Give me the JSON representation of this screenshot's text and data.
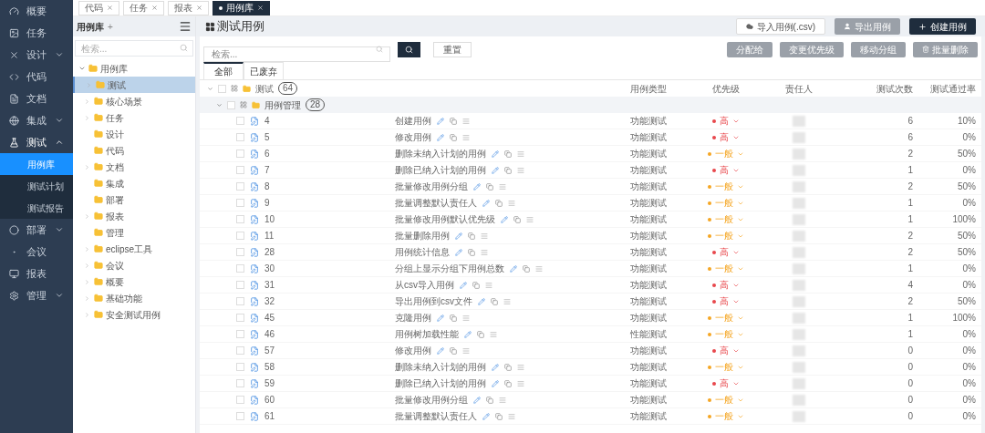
{
  "sidebar": {
    "items": [
      {
        "label": "概要",
        "expandable": false
      },
      {
        "label": "任务",
        "expandable": false
      },
      {
        "label": "设计",
        "expandable": true,
        "expanded": false
      },
      {
        "label": "代码",
        "expandable": false
      },
      {
        "label": "文档",
        "expandable": false
      },
      {
        "label": "集成",
        "expandable": true,
        "expanded": false
      },
      {
        "label": "测试",
        "expandable": true,
        "expanded": true,
        "children": [
          {
            "label": "用例库",
            "selected": true
          },
          {
            "label": "测试计划",
            "selected": false
          },
          {
            "label": "测试报告",
            "selected": false
          }
        ]
      },
      {
        "label": "部署",
        "expandable": true,
        "expanded": false
      },
      {
        "label": "会议",
        "expandable": false
      },
      {
        "label": "报表",
        "expandable": false
      },
      {
        "label": "管理",
        "expandable": true,
        "expanded": false
      }
    ]
  },
  "open_tabs": [
    {
      "label": "代码",
      "selected": false
    },
    {
      "label": "任务",
      "selected": false
    },
    {
      "label": "报表",
      "selected": false
    },
    {
      "label": "用例库",
      "selected": true
    }
  ],
  "tree_panel": {
    "title": "用例库",
    "add": "+",
    "search": {
      "placeholder": "检索..."
    },
    "root": {
      "label": "用例库",
      "expanded": true,
      "children": [
        {
          "label": "测试",
          "has_children": true,
          "selected": true
        },
        {
          "label": "核心场景",
          "has_children": true,
          "selected": false
        },
        {
          "label": "任务",
          "has_children": true,
          "selected": false
        },
        {
          "label": "设计",
          "has_children": false,
          "selected": false
        },
        {
          "label": "代码",
          "has_children": false,
          "selected": false
        },
        {
          "label": "文档",
          "has_children": true,
          "selected": false
        },
        {
          "label": "集成",
          "has_children": false,
          "selected": false
        },
        {
          "label": "部署",
          "has_children": false,
          "selected": false
        },
        {
          "label": "报表",
          "has_children": true,
          "selected": false
        },
        {
          "label": "管理",
          "has_children": false,
          "selected": false
        },
        {
          "label": "eclipse工具",
          "has_children": true,
          "selected": false
        },
        {
          "label": "会议",
          "has_children": true,
          "selected": false
        },
        {
          "label": "概要",
          "has_children": true,
          "selected": false
        },
        {
          "label": "基础功能",
          "has_children": true,
          "selected": false
        },
        {
          "label": "安全测试用例",
          "has_children": true,
          "selected": false
        }
      ]
    }
  },
  "page": {
    "title": "测试用例",
    "header_buttons": [
      {
        "label": "导入用例(.csv)",
        "kind": "outline"
      },
      {
        "label": "导出用例",
        "kind": "gray"
      },
      {
        "label": "创建用例",
        "kind": "dark"
      }
    ],
    "search": {
      "placeholder": "检索...",
      "reset": "重置"
    },
    "actions": [
      "分配给",
      "变更优先级",
      "移动分组",
      "批量删除"
    ],
    "tabs": [
      {
        "label": "全部",
        "selected": true
      },
      {
        "label": "已废弃",
        "selected": false
      }
    ]
  },
  "table": {
    "columns": [
      "用例类型",
      "优先级",
      "责任人",
      "测试次数",
      "测试通过率"
    ],
    "group": {
      "label": "测试",
      "count": "64",
      "expanded": true,
      "checked": false
    },
    "subgroup": {
      "label": "用例管理",
      "count": "28",
      "expanded": true,
      "checked": false
    },
    "rows": [
      {
        "id": "4",
        "title": "创建用例",
        "type": "功能测试",
        "priority": "高",
        "color": "#e8474c",
        "runs": "6",
        "pass_rate": "10%",
        "checked": false
      },
      {
        "id": "5",
        "title": "修改用例",
        "type": "功能测试",
        "priority": "高",
        "color": "#e8474c",
        "runs": "6",
        "pass_rate": "0%",
        "checked": false
      },
      {
        "id": "6",
        "title": "删除未纳入计划的用例",
        "type": "功能测试",
        "priority": "一般",
        "color": "#f5a623",
        "runs": "2",
        "pass_rate": "50%",
        "checked": false
      },
      {
        "id": "7",
        "title": "删除已纳入计划的用例",
        "type": "功能测试",
        "priority": "高",
        "color": "#e8474c",
        "runs": "1",
        "pass_rate": "0%",
        "checked": false
      },
      {
        "id": "8",
        "title": "批量修改用例分组",
        "type": "功能测试",
        "priority": "一般",
        "color": "#f5a623",
        "runs": "2",
        "pass_rate": "50%",
        "checked": false
      },
      {
        "id": "9",
        "title": "批量调整默认责任人",
        "type": "功能测试",
        "priority": "一般",
        "color": "#f5a623",
        "runs": "1",
        "pass_rate": "0%",
        "checked": false
      },
      {
        "id": "10",
        "title": "批量修改用例默认优先级",
        "type": "功能测试",
        "priority": "一般",
        "color": "#f5a623",
        "runs": "1",
        "pass_rate": "100%",
        "checked": false
      },
      {
        "id": "11",
        "title": "批量删除用例",
        "type": "功能测试",
        "priority": "一般",
        "color": "#f5a623",
        "runs": "2",
        "pass_rate": "50%",
        "checked": false
      },
      {
        "id": "28",
        "title": "用例统计信息",
        "type": "功能测试",
        "priority": "高",
        "color": "#e8474c",
        "runs": "2",
        "pass_rate": "50%",
        "checked": false
      },
      {
        "id": "30",
        "title": "分组上显示分组下用例总数",
        "type": "功能测试",
        "priority": "一般",
        "color": "#f5a623",
        "runs": "1",
        "pass_rate": "0%",
        "checked": false
      },
      {
        "id": "31",
        "title": "从csv导入用例",
        "type": "功能测试",
        "priority": "高",
        "color": "#e8474c",
        "runs": "4",
        "pass_rate": "0%",
        "checked": false
      },
      {
        "id": "32",
        "title": "导出用例到csv文件",
        "type": "功能测试",
        "priority": "高",
        "color": "#e8474c",
        "runs": "2",
        "pass_rate": "50%",
        "checked": false
      },
      {
        "id": "45",
        "title": "克隆用例",
        "type": "功能测试",
        "priority": "一般",
        "color": "#f5a623",
        "runs": "1",
        "pass_rate": "100%",
        "checked": false
      },
      {
        "id": "46",
        "title": "用例树加载性能",
        "type": "性能测试",
        "priority": "一般",
        "color": "#f5a623",
        "runs": "1",
        "pass_rate": "0%",
        "checked": false
      },
      {
        "id": "57",
        "title": "修改用例",
        "type": "功能测试",
        "priority": "高",
        "color": "#e8474c",
        "runs": "0",
        "pass_rate": "0%",
        "checked": false
      },
      {
        "id": "58",
        "title": "删除未纳入计划的用例",
        "type": "功能测试",
        "priority": "一般",
        "color": "#f5a623",
        "runs": "0",
        "pass_rate": "0%",
        "checked": false
      },
      {
        "id": "59",
        "title": "删除已纳入计划的用例",
        "type": "功能测试",
        "priority": "高",
        "color": "#e8474c",
        "runs": "0",
        "pass_rate": "0%",
        "checked": false
      },
      {
        "id": "60",
        "title": "批量修改用例分组",
        "type": "功能测试",
        "priority": "一般",
        "color": "#f5a623",
        "runs": "0",
        "pass_rate": "0%",
        "checked": false
      },
      {
        "id": "61",
        "title": "批量调整默认责任人",
        "type": "功能测试",
        "priority": "一般",
        "color": "#f5a623",
        "runs": "0",
        "pass_rate": "0%",
        "checked": false
      }
    ]
  }
}
